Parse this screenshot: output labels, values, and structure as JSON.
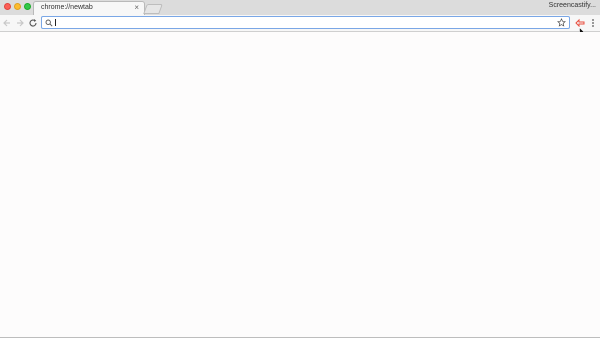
{
  "tab": {
    "title": "chrome://newtab",
    "close_label": "×"
  },
  "profile": {
    "name": "Screencastify..."
  },
  "omnibox": {
    "value": "",
    "placeholder": ""
  },
  "icons": {
    "back": "arrow-left-icon",
    "forward": "arrow-right-icon",
    "reload": "reload-icon",
    "search": "search-icon",
    "bookmark": "star-icon",
    "extension": "screencastify-extension-icon",
    "menu": "vertical-dots-menu-icon"
  },
  "colors": {
    "accent": "#7aa7e6",
    "extension": "#e84c3d",
    "close": "#fc5f57",
    "minimize": "#fdbc2e",
    "maximize": "#33c748"
  }
}
